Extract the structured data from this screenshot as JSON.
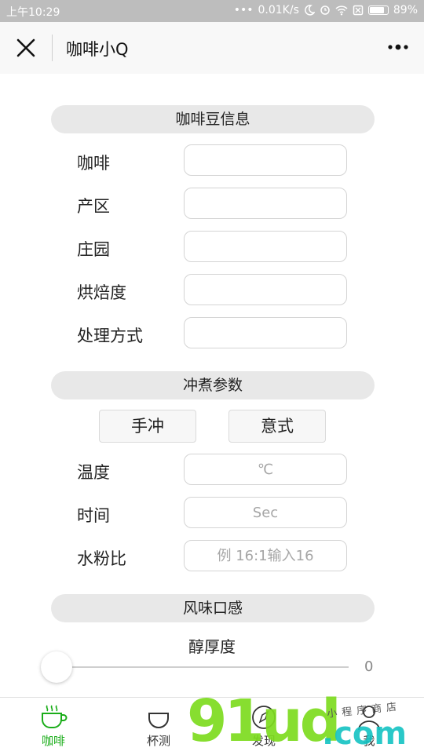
{
  "status_bar": {
    "time": "上午10:29",
    "signal_dots": "•••",
    "net_speed": "0.01K/s",
    "battery": "89%",
    "battery_level": 0.89
  },
  "nav": {
    "title": "咖啡小Q"
  },
  "bean_info": {
    "header": "咖啡豆信息",
    "rows": [
      {
        "label": "咖啡",
        "value": "",
        "placeholder": ""
      },
      {
        "label": "产区",
        "value": "",
        "placeholder": ""
      },
      {
        "label": "庄园",
        "value": "",
        "placeholder": ""
      },
      {
        "label": "烘焙度",
        "value": "",
        "placeholder": ""
      },
      {
        "label": "处理方式",
        "value": "",
        "placeholder": ""
      }
    ]
  },
  "brew_params": {
    "header": "冲煮参数",
    "modes": [
      "手冲",
      "意式"
    ],
    "rows": [
      {
        "label": "温度",
        "placeholder": "℃"
      },
      {
        "label": "时间",
        "placeholder": "Sec"
      },
      {
        "label": "水粉比",
        "placeholder": "例 16:1输入16"
      }
    ]
  },
  "flavor": {
    "header": "风味口感",
    "body_label": "醇厚度",
    "body_value": "0",
    "slider_level": 0
  },
  "tabs": [
    {
      "label": "咖啡",
      "icon": "coffee-cup-icon",
      "active": true
    },
    {
      "label": "杯测",
      "icon": "cup-icon",
      "active": false
    },
    {
      "label": "发现",
      "icon": "compass-icon",
      "active": false
    },
    {
      "label": "我",
      "icon": "person-icon",
      "active": false
    }
  ],
  "watermark": {
    "main": "91ud",
    "suffix": ".com",
    "tagline": "小程序商店"
  },
  "colors": {
    "accent": "#1aad19",
    "section_bg": "#e8e8e8",
    "status_bar_bg": "#bdbdbd",
    "watermark_green": "#7ddc1f",
    "watermark_teal": "#13c3c3"
  }
}
